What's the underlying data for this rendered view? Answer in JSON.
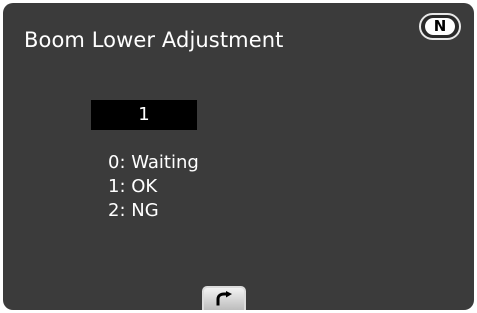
{
  "screen": {
    "title": "Boom Lower Adjustment",
    "mode_badge": "N"
  },
  "value_display": {
    "value": "1"
  },
  "status_legend": [
    "0: Waiting",
    "1: OK",
    "2: NG"
  ],
  "footer": {
    "back_icon": "return-arrow-icon"
  },
  "colors": {
    "background": "#3b3b3b",
    "text": "#ffffff",
    "value_box": "#000000"
  }
}
